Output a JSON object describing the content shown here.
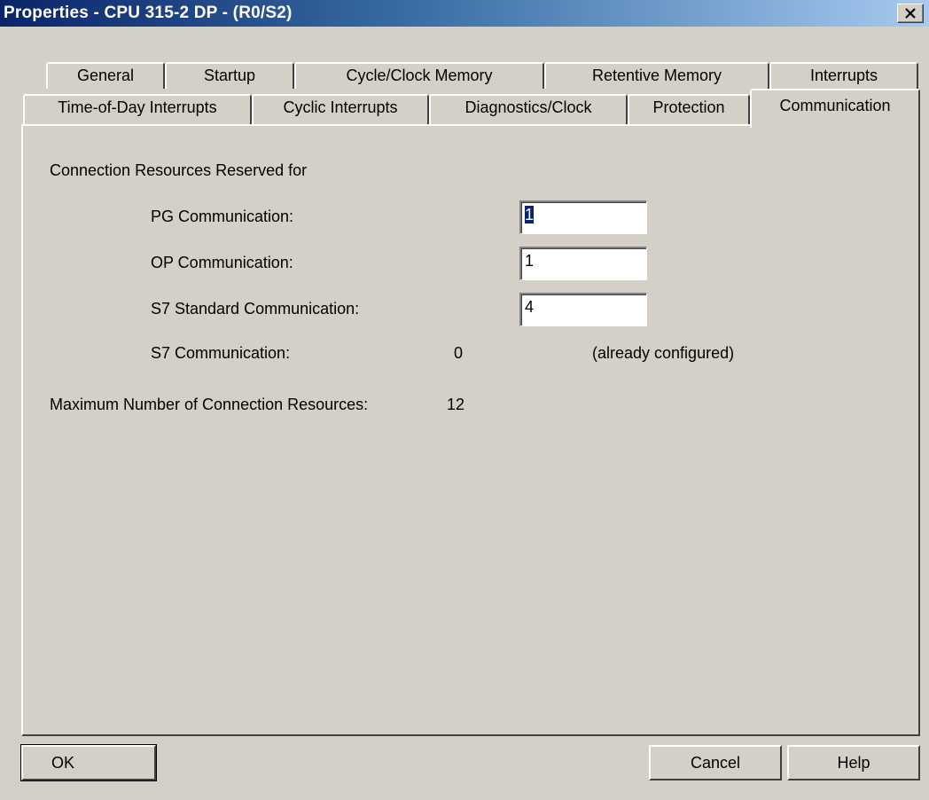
{
  "window": {
    "title": "Properties - CPU 315-2 DP - (R0/S2)"
  },
  "tabs_row1": [
    "General",
    "Startup",
    "Cycle/Clock Memory",
    "Retentive Memory",
    "Interrupts"
  ],
  "tabs_row2": [
    "Time-of-Day Interrupts",
    "Cyclic Interrupts",
    "Diagnostics/Clock",
    "Protection",
    "Communication"
  ],
  "active_tab": "Communication",
  "communication": {
    "section_label": "Connection Resources Reserved for",
    "pg_label": "PG Communication:",
    "pg_value": "1",
    "op_label": "OP Communication:",
    "op_value": "1",
    "s7std_label": "S7 Standard Communication:",
    "s7std_value": "4",
    "s7_label": "S7 Communication:",
    "s7_value": "0",
    "s7_note": "(already configured)",
    "max_label": "Maximum Number of Connection Resources:",
    "max_value": "12"
  },
  "buttons": {
    "ok": "OK",
    "cancel": "Cancel",
    "help": "Help"
  },
  "icons": {
    "close": "close-icon"
  }
}
